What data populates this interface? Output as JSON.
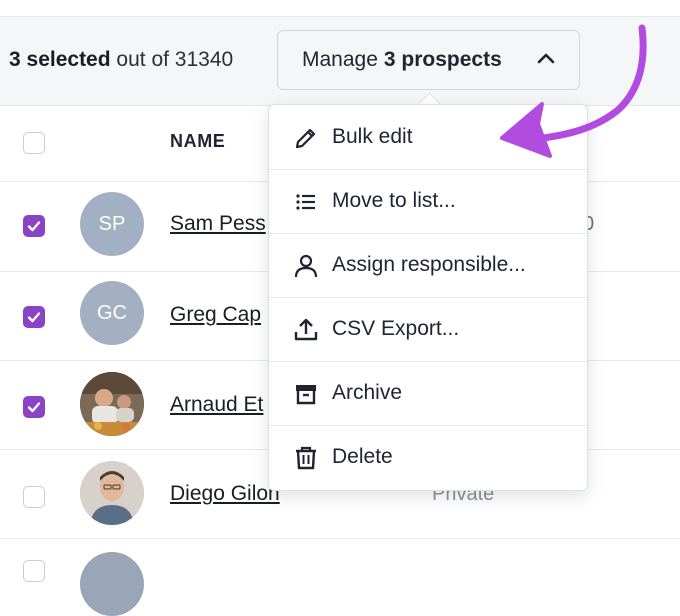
{
  "selection": {
    "count_text": "3 selected",
    "rest_text": "out of 31340"
  },
  "manage_button": {
    "label": "Manage",
    "bold_label": "3 prospects",
    "icon": "chevron-up-icon"
  },
  "table": {
    "header": {
      "name": "NAME"
    },
    "rows": [
      {
        "checked": true,
        "avatar_initials": "SP",
        "name": "Sam Pess",
        "extra": "0"
      },
      {
        "checked": true,
        "avatar_initials": "GC",
        "name": "Greg Cap",
        "extra": ""
      },
      {
        "checked": true,
        "avatar_initials": "",
        "avatar_type": "photo",
        "name": "Arnaud Et",
        "extra": ""
      },
      {
        "checked": false,
        "avatar_initials": "",
        "avatar_type": "photo",
        "name": "Diego Gilon",
        "extra": "Private"
      }
    ]
  },
  "menu": {
    "items": [
      {
        "label": "Bulk edit",
        "icon": "pencil-icon"
      },
      {
        "label": "Move to list...",
        "icon": "list-icon"
      },
      {
        "label": "Assign responsible...",
        "icon": "user-icon"
      },
      {
        "label": "CSV Export...",
        "icon": "upload-icon"
      },
      {
        "label": "Archive",
        "icon": "archive-icon"
      },
      {
        "label": "Delete",
        "icon": "trash-icon"
      }
    ]
  },
  "colors": {
    "accent": "#8b43c6",
    "arrow": "#b24be0",
    "avatar_bg": "#a3b0c2"
  }
}
